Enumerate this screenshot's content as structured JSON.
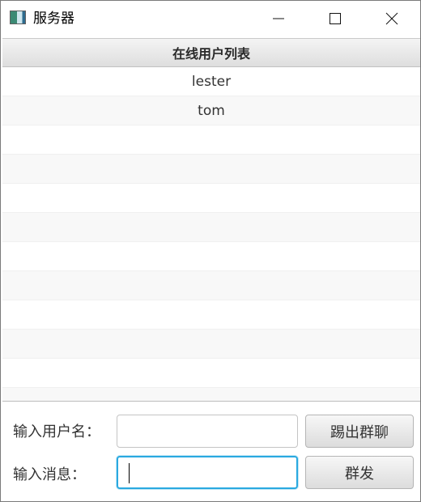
{
  "window": {
    "title": "服务器",
    "icon": "app-window-icon"
  },
  "table": {
    "header": "在线用户列表",
    "rows": [
      "lester",
      "tom",
      "",
      "",
      "",
      "",
      "",
      "",
      "",
      "",
      "",
      ""
    ]
  },
  "form": {
    "username_label": "输入用户名：",
    "username_value": "",
    "kick_button": "踢出群聊",
    "message_label": "输入消息：",
    "message_value": "",
    "broadcast_button": "群发"
  },
  "colors": {
    "focus_border": "#2aa9e0",
    "header_gradient_top": "#f4f4f4",
    "header_gradient_bottom": "#dedede"
  }
}
